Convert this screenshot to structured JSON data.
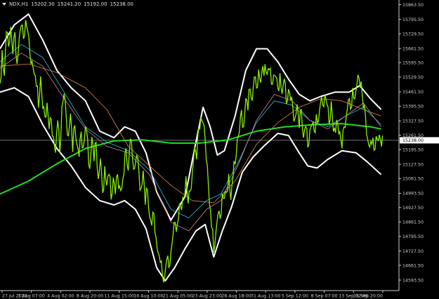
{
  "header": {
    "symbol": "NDX,H1",
    "open": "15202.30",
    "high": "15241.20",
    "low": "15192.00",
    "close": "15238.00"
  },
  "chart_data": {
    "type": "line",
    "title": "",
    "xlabel": "",
    "ylabel": "",
    "ylim": [
      14545,
      15885
    ],
    "y_ticks": [
      "15863.50",
      "15795.50",
      "15729.50",
      "15661.50",
      "15595.50",
      "15529.50",
      "15461.50",
      "15395.50",
      "15327.50",
      "15261.50",
      "15195.50",
      "15127.50",
      "15061.50",
      "14993.50",
      "14927.50",
      "14861.50",
      "14795.50",
      "14727.50",
      "14661.50",
      "14593.50"
    ],
    "x_ticks": [
      "27 Jul 2023",
      "1 Aug 07:00",
      "4 Aug 02:00",
      "8 Aug 20:00",
      "11 Aug 15:00",
      "16 Aug 10:00",
      "21 Aug 05:00",
      "23 Aug 23:00",
      "28 Aug 18:00",
      "31 Aug 13:00",
      "5 Sep 12:00",
      "8 Sep 07:00",
      "13 Sep 02:00",
      "15 Sep 20:00"
    ],
    "current_price": "15238.00",
    "current_price_value": 15238,
    "price_path": [
      [
        0,
        15500
      ],
      [
        3,
        15640
      ],
      [
        6,
        15540
      ],
      [
        9,
        15720
      ],
      [
        12,
        15680
      ],
      [
        15,
        15760
      ],
      [
        18,
        15650
      ],
      [
        21,
        15730
      ],
      [
        24,
        15610
      ],
      [
        27,
        15700
      ],
      [
        30,
        15770
      ],
      [
        33,
        15690
      ],
      [
        36,
        15800
      ],
      [
        39,
        15720
      ],
      [
        42,
        15650
      ],
      [
        45,
        15600
      ],
      [
        48,
        15560
      ],
      [
        51,
        15480
      ],
      [
        54,
        15410
      ],
      [
        57,
        15520
      ],
      [
        60,
        15390
      ],
      [
        63,
        15330
      ],
      [
        66,
        15420
      ],
      [
        69,
        15290
      ],
      [
        72,
        15350
      ],
      [
        75,
        15250
      ],
      [
        78,
        15200
      ],
      [
        81,
        15320
      ],
      [
        84,
        15180
      ],
      [
        87,
        15380
      ],
      [
        90,
        15460
      ],
      [
        93,
        15330
      ],
      [
        96,
        15270
      ],
      [
        99,
        15360
      ],
      [
        102,
        15200
      ],
      [
        105,
        15300
      ],
      [
        108,
        15240
      ],
      [
        111,
        15150
      ],
      [
        114,
        15280
      ],
      [
        117,
        15190
      ],
      [
        120,
        15310
      ],
      [
        123,
        15220
      ],
      [
        126,
        15120
      ],
      [
        129,
        15250
      ],
      [
        132,
        15160
      ],
      [
        135,
        15220
      ],
      [
        138,
        15060
      ],
      [
        141,
        15140
      ],
      [
        144,
        15000
      ],
      [
        147,
        15100
      ],
      [
        150,
        15040
      ],
      [
        153,
        15080
      ],
      [
        156,
        14980
      ],
      [
        159,
        15060
      ],
      [
        162,
        15010
      ],
      [
        165,
        15070
      ],
      [
        168,
        15030
      ],
      [
        171,
        15000
      ],
      [
        174,
        15090
      ],
      [
        177,
        15180
      ],
      [
        180,
        15110
      ],
      [
        183,
        15240
      ],
      [
        186,
        15170
      ],
      [
        189,
        15100
      ],
      [
        192,
        15190
      ],
      [
        195,
        15080
      ],
      [
        198,
        15020
      ],
      [
        201,
        15080
      ],
      [
        204,
        14950
      ],
      [
        207,
        15010
      ],
      [
        210,
        14900
      ],
      [
        213,
        14840
      ],
      [
        216,
        14920
      ],
      [
        219,
        14780
      ],
      [
        222,
        14720
      ],
      [
        225,
        14660
      ],
      [
        228,
        14620
      ],
      [
        231,
        14590
      ],
      [
        234,
        14700
      ],
      [
        237,
        14650
      ],
      [
        240,
        14740
      ],
      [
        243,
        14800
      ],
      [
        246,
        14880
      ],
      [
        249,
        14840
      ],
      [
        252,
        14950
      ],
      [
        255,
        14900
      ],
      [
        258,
        14980
      ],
      [
        261,
        15050
      ],
      [
        264,
        14960
      ],
      [
        267,
        15000
      ],
      [
        270,
        15110
      ],
      [
        273,
        15200
      ],
      [
        276,
        15150
      ],
      [
        279,
        15280
      ],
      [
        282,
        15350
      ],
      [
        285,
        15300
      ],
      [
        288,
        15250
      ],
      [
        291,
        15120
      ],
      [
        294,
        14960
      ],
      [
        297,
        14830
      ],
      [
        300,
        14740
      ],
      [
        303,
        14800
      ],
      [
        306,
        14900
      ],
      [
        309,
        14860
      ],
      [
        312,
        15000
      ],
      [
        315,
        14950
      ],
      [
        318,
        15010
      ],
      [
        321,
        15080
      ],
      [
        324,
        14980
      ],
      [
        327,
        15060
      ],
      [
        330,
        15150
      ],
      [
        333,
        15230
      ],
      [
        336,
        15280
      ],
      [
        339,
        15360
      ],
      [
        342,
        15310
      ],
      [
        345,
        15430
      ],
      [
        348,
        15390
      ],
      [
        351,
        15470
      ],
      [
        354,
        15440
      ],
      [
        357,
        15520
      ],
      [
        360,
        15480
      ],
      [
        363,
        15550
      ],
      [
        366,
        15510
      ],
      [
        369,
        15560
      ],
      [
        372,
        15600
      ],
      [
        375,
        15540
      ],
      [
        378,
        15580
      ],
      [
        381,
        15490
      ],
      [
        384,
        15560
      ],
      [
        387,
        15520
      ],
      [
        390,
        15480
      ],
      [
        393,
        15530
      ],
      [
        396,
        15460
      ],
      [
        399,
        15500
      ],
      [
        402,
        15420
      ],
      [
        405,
        15470
      ],
      [
        408,
        15440
      ],
      [
        411,
        15380
      ],
      [
        414,
        15340
      ],
      [
        417,
        15390
      ],
      [
        420,
        15300
      ],
      [
        423,
        15360
      ],
      [
        426,
        15260
      ],
      [
        429,
        15300
      ],
      [
        432,
        15220
      ],
      [
        435,
        15280
      ],
      [
        438,
        15330
      ],
      [
        441,
        15270
      ],
      [
        444,
        15360
      ],
      [
        447,
        15310
      ],
      [
        450,
        15420
      ],
      [
        453,
        15380
      ],
      [
        456,
        15460
      ],
      [
        459,
        15400
      ],
      [
        462,
        15330
      ],
      [
        465,
        15410
      ],
      [
        468,
        15300
      ],
      [
        471,
        15260
      ],
      [
        474,
        15320
      ],
      [
        477,
        15260
      ],
      [
        480,
        15210
      ],
      [
        483,
        15300
      ],
      [
        486,
        15360
      ],
      [
        489,
        15420
      ],
      [
        492,
        15400
      ],
      [
        495,
        15470
      ],
      [
        498,
        15430
      ],
      [
        501,
        15480
      ],
      [
        504,
        15530
      ],
      [
        507,
        15490
      ],
      [
        510,
        15400
      ],
      [
        513,
        15350
      ],
      [
        516,
        15260
      ],
      [
        519,
        15200
      ],
      [
        522,
        15240
      ],
      [
        525,
        15180
      ],
      [
        528,
        15260
      ],
      [
        531,
        15220
      ],
      [
        534,
        15250
      ],
      [
        537,
        15238
      ]
    ],
    "series": [
      {
        "color": "#ffffff",
        "values": [
          [
            0,
            15660
          ],
          [
            20,
            15770
          ],
          [
            40,
            15820
          ],
          [
            60,
            15700
          ],
          [
            80,
            15560
          ],
          [
            100,
            15480
          ],
          [
            120,
            15420
          ],
          [
            140,
            15280
          ],
          [
            160,
            15250
          ],
          [
            175,
            15300
          ],
          [
            190,
            15280
          ],
          [
            205,
            15180
          ],
          [
            220,
            15000
          ],
          [
            240,
            14870
          ],
          [
            260,
            14980
          ],
          [
            275,
            15230
          ],
          [
            285,
            15390
          ],
          [
            295,
            15300
          ],
          [
            305,
            15170
          ],
          [
            315,
            15190
          ],
          [
            330,
            15350
          ],
          [
            345,
            15560
          ],
          [
            360,
            15660
          ],
          [
            375,
            15660
          ],
          [
            390,
            15600
          ],
          [
            405,
            15520
          ],
          [
            420,
            15450
          ],
          [
            435,
            15420
          ],
          [
            450,
            15440
          ],
          [
            470,
            15460
          ],
          [
            490,
            15460
          ],
          [
            505,
            15490
          ],
          [
            520,
            15430
          ],
          [
            535,
            15380
          ]
        ]
      },
      {
        "color": "#ffffff",
        "values": [
          [
            0,
            15460
          ],
          [
            20,
            15480
          ],
          [
            40,
            15440
          ],
          [
            60,
            15310
          ],
          [
            80,
            15200
          ],
          [
            100,
            15120
          ],
          [
            120,
            15020
          ],
          [
            140,
            14960
          ],
          [
            160,
            14940
          ],
          [
            175,
            14960
          ],
          [
            190,
            14920
          ],
          [
            205,
            14830
          ],
          [
            220,
            14650
          ],
          [
            232,
            14590
          ],
          [
            245,
            14650
          ],
          [
            260,
            14740
          ],
          [
            275,
            14820
          ],
          [
            288,
            14850
          ],
          [
            300,
            14700
          ],
          [
            312,
            14820
          ],
          [
            325,
            14930
          ],
          [
            340,
            15090
          ],
          [
            355,
            15160
          ],
          [
            370,
            15210
          ],
          [
            390,
            15270
          ],
          [
            405,
            15260
          ],
          [
            420,
            15180
          ],
          [
            432,
            15120
          ],
          [
            445,
            15110
          ],
          [
            460,
            15150
          ],
          [
            480,
            15190
          ],
          [
            500,
            15180
          ],
          [
            515,
            15140
          ],
          [
            535,
            15080
          ]
        ]
      },
      {
        "color": "#22dd22",
        "values": [
          [
            0,
            14990
          ],
          [
            40,
            15050
          ],
          [
            80,
            15130
          ],
          [
            120,
            15200
          ],
          [
            160,
            15235
          ],
          [
            200,
            15240
          ],
          [
            240,
            15225
          ],
          [
            280,
            15225
          ],
          [
            320,
            15240
          ],
          [
            360,
            15280
          ],
          [
            400,
            15300
          ],
          [
            440,
            15310
          ],
          [
            480,
            15315
          ],
          [
            520,
            15300
          ],
          [
            535,
            15290
          ]
        ]
      },
      {
        "color": "#e08a3c",
        "values": [
          [
            0,
            15580
          ],
          [
            40,
            15590
          ],
          [
            80,
            15550
          ],
          [
            120,
            15480
          ],
          [
            150,
            15380
          ],
          [
            180,
            15210
          ],
          [
            210,
            15120
          ],
          [
            240,
            15030
          ],
          [
            270,
            14960
          ],
          [
            300,
            14950
          ],
          [
            330,
            15050
          ],
          [
            360,
            15220
          ],
          [
            390,
            15320
          ],
          [
            420,
            15390
          ],
          [
            450,
            15430
          ],
          [
            480,
            15420
          ],
          [
            510,
            15380
          ],
          [
            535,
            15350
          ]
        ]
      },
      {
        "color": "#26c6da",
        "values": [
          [
            0,
            15600
          ],
          [
            30,
            15680
          ],
          [
            60,
            15620
          ],
          [
            90,
            15460
          ],
          [
            120,
            15300
          ],
          [
            150,
            15230
          ],
          [
            180,
            15190
          ],
          [
            210,
            15100
          ],
          [
            240,
            14920
          ],
          [
            265,
            14880
          ],
          [
            290,
            14960
          ],
          [
            310,
            14990
          ],
          [
            335,
            15140
          ],
          [
            360,
            15320
          ],
          [
            385,
            15420
          ],
          [
            410,
            15400
          ],
          [
            435,
            15330
          ],
          [
            460,
            15300
          ],
          [
            485,
            15350
          ],
          [
            510,
            15390
          ],
          [
            535,
            15310
          ]
        ]
      },
      {
        "color": "#d08aa0",
        "values": [
          [
            0,
            15570
          ],
          [
            30,
            15640
          ],
          [
            60,
            15580
          ],
          [
            90,
            15430
          ],
          [
            120,
            15290
          ],
          [
            150,
            15210
          ],
          [
            180,
            15180
          ],
          [
            210,
            15080
          ],
          [
            240,
            14860
          ],
          [
            265,
            14820
          ],
          [
            290,
            14920
          ],
          [
            310,
            14960
          ],
          [
            335,
            15130
          ],
          [
            360,
            15330
          ],
          [
            385,
            15450
          ],
          [
            410,
            15420
          ],
          [
            435,
            15330
          ],
          [
            460,
            15290
          ],
          [
            485,
            15350
          ],
          [
            510,
            15410
          ],
          [
            535,
            15300
          ]
        ]
      }
    ]
  }
}
